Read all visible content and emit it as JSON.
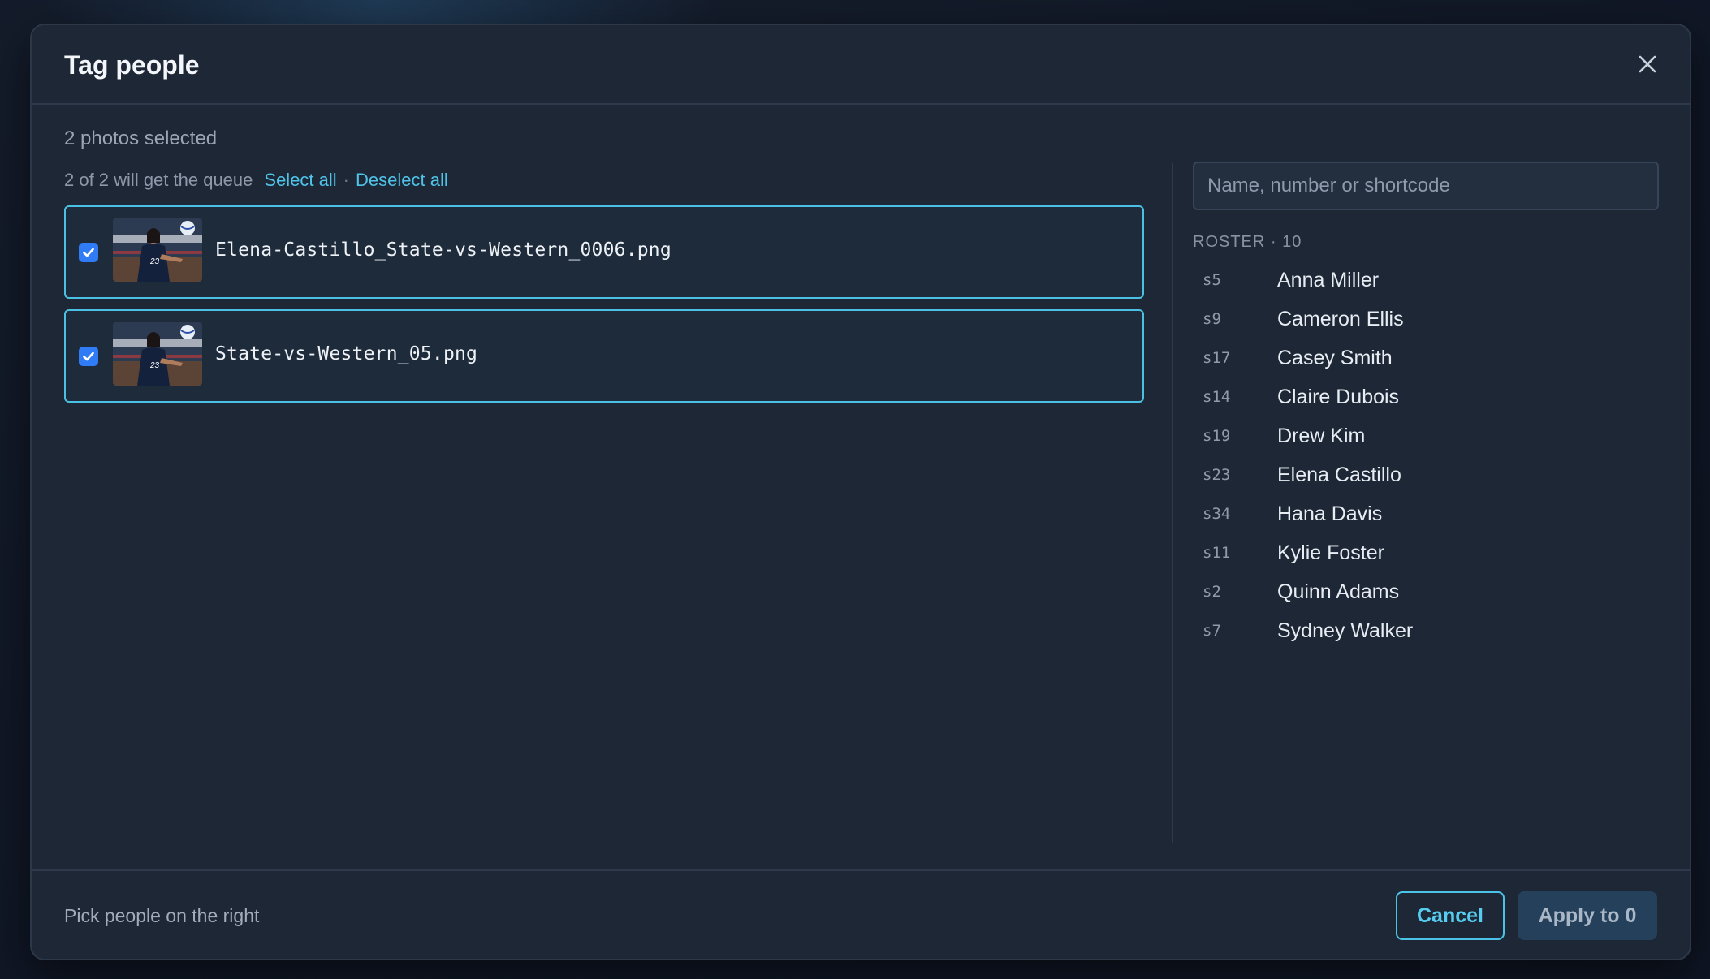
{
  "modal": {
    "title": "Tag people",
    "close_icon": "close-icon"
  },
  "selection": {
    "photos_selected": "2 photos selected",
    "queue_text": "2 of 2 will get the queue",
    "select_all": "Select all",
    "separator": "·",
    "deselect_all": "Deselect all"
  },
  "photos": [
    {
      "filename": "Elena-Castillo_State-vs-Western_0006.png",
      "checked": true,
      "jersey": "23"
    },
    {
      "filename": "State-vs-Western_05.png",
      "checked": true,
      "jersey": "23"
    }
  ],
  "search": {
    "placeholder": "Name, number or shortcode",
    "value": ""
  },
  "roster": {
    "heading": "ROSTER · 10",
    "people": [
      {
        "code": "s5",
        "name": "Anna Miller"
      },
      {
        "code": "s9",
        "name": "Cameron Ellis"
      },
      {
        "code": "s17",
        "name": "Casey Smith"
      },
      {
        "code": "s14",
        "name": "Claire Dubois"
      },
      {
        "code": "s19",
        "name": "Drew Kim"
      },
      {
        "code": "s23",
        "name": "Elena Castillo"
      },
      {
        "code": "s34",
        "name": "Hana Davis"
      },
      {
        "code": "s11",
        "name": "Kylie Foster"
      },
      {
        "code": "s2",
        "name": "Quinn Adams"
      },
      {
        "code": "s7",
        "name": "Sydney Walker"
      }
    ]
  },
  "footer": {
    "hint": "Pick people on the right",
    "cancel_label": "Cancel",
    "apply_label": "Apply to 0"
  },
  "colors": {
    "accent": "#4bc3e8",
    "checkbox": "#2f7cf6",
    "modal_bg": "#1e2735",
    "apply_bg": "#24405a"
  }
}
